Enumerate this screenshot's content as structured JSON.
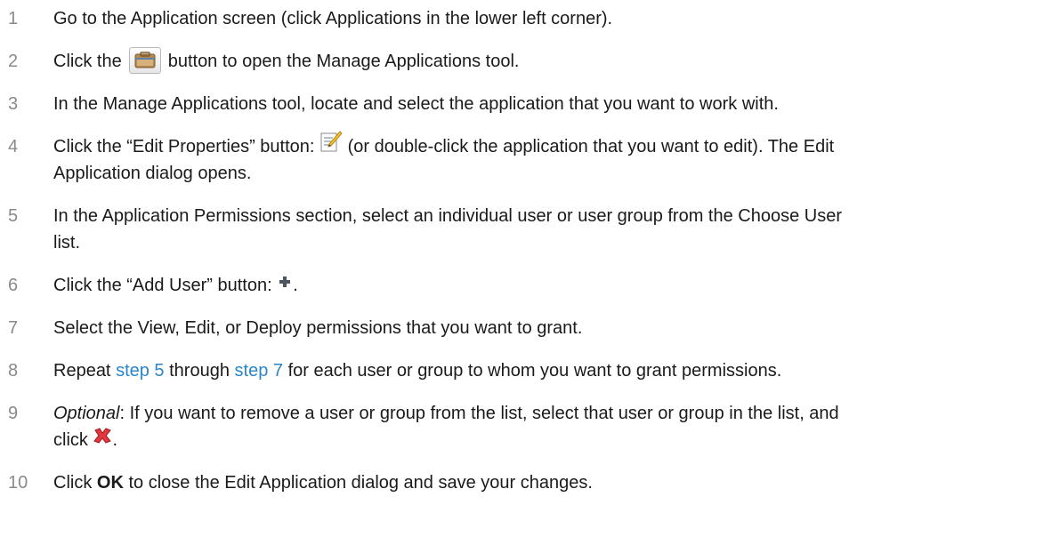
{
  "steps": [
    {
      "num": "1",
      "text": "Go to the Application screen (click Applications in the lower left corner)."
    },
    {
      "num": "2",
      "before": "Click the",
      "after": "button to open the Manage Applications tool.",
      "icon": "toolbox-icon"
    },
    {
      "num": "3",
      "text": "In the Manage Applications tool, locate and select the application that you want to work with."
    },
    {
      "num": "4",
      "before": "Click the “Edit Properties” button:",
      "after": "(or double-click the application that you want to edit). The Edit",
      "line2": "Application dialog opens.",
      "icon": "edit-properties-icon"
    },
    {
      "num": "5",
      "text": "In the Application Permissions section, select an individual user or user group from the Choose User",
      "line2": "list."
    },
    {
      "num": "6",
      "before": "Click the “Add User” button:",
      "after": ".",
      "icon": "plus-icon"
    },
    {
      "num": "7",
      "text": "Select the View, Edit, or Deploy permissions that you want to grant."
    },
    {
      "num": "8",
      "before": "Repeat",
      "link1": "step 5",
      "middle": "through",
      "link2": "step 7",
      "after": "for each user or group to whom you want to grant permissions."
    },
    {
      "num": "9",
      "optional": "Optional",
      "text": ": If you want to remove a user or group from the list, select that user or group in the list, and",
      "line2_before": "click",
      "line2_after": ".",
      "icon": "remove-icon"
    },
    {
      "num": "10",
      "before": "Click",
      "bold": "OK",
      "after": "to close the Edit Application dialog and save your changes."
    }
  ],
  "colors": {
    "link": "#2a86c8",
    "number": "#8a8a8a",
    "remove": "#e0383e"
  }
}
